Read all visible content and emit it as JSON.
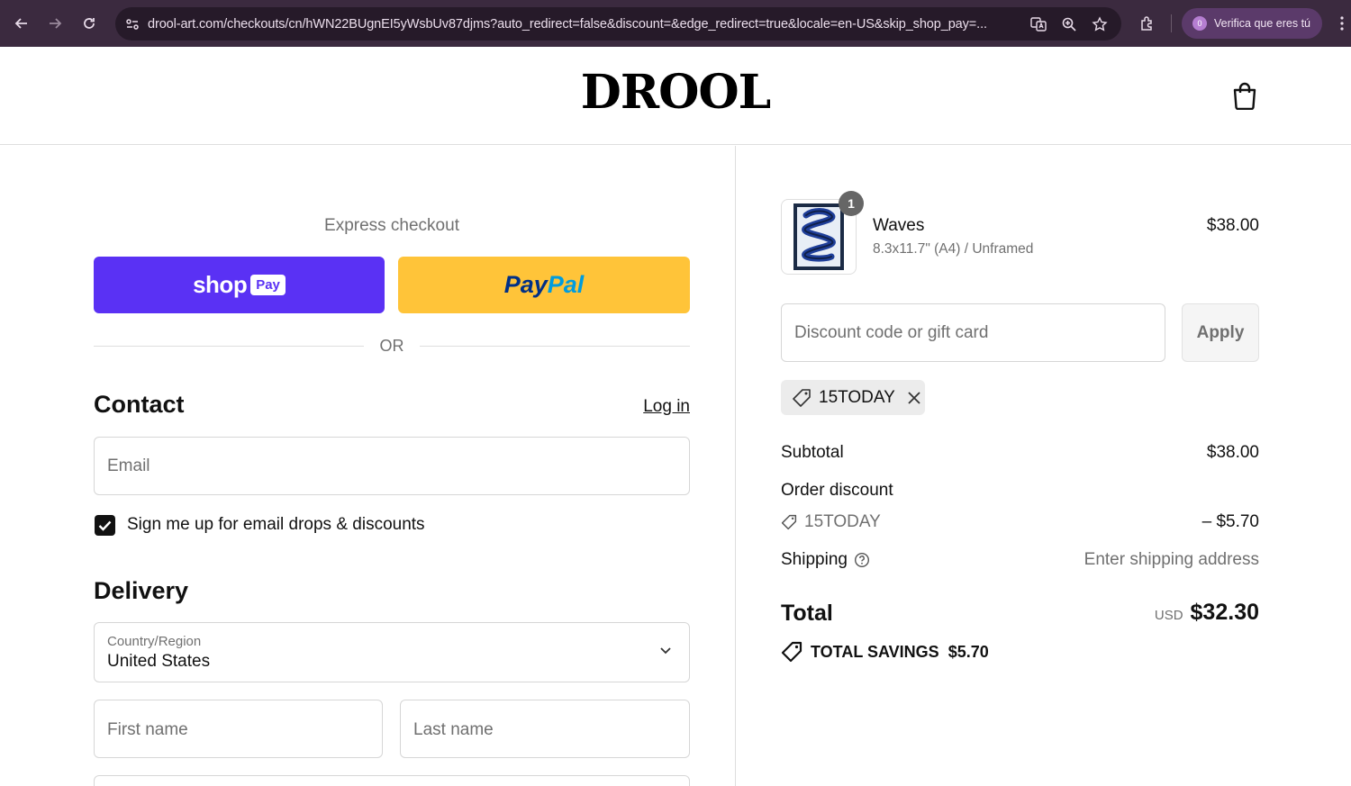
{
  "browser": {
    "url": "drool-art.com/checkouts/cn/hWN22BUgnEI5yWsbUv87djms?auto_redirect=false&discount=&edge_redirect=true&locale=en-US&skip_shop_pay=...",
    "profile_label": "Verifica que eres tú",
    "profile_initial": "0"
  },
  "header": {
    "logo": "DROOL"
  },
  "express": {
    "label": "Express checkout",
    "shop_word": "shop",
    "shop_pay_badge": "Pay",
    "paypal_a": "Pay",
    "paypal_b": "Pal",
    "or": "OR"
  },
  "contact": {
    "title": "Contact",
    "login": "Log in",
    "email_placeholder": "Email",
    "newsletter_label": "Sign me up for email drops & discounts",
    "newsletter_checked": true
  },
  "delivery": {
    "title": "Delivery",
    "country_label": "Country/Region",
    "country_value": "United States",
    "first_name_placeholder": "First name",
    "last_name_placeholder": "Last name"
  },
  "cart": {
    "item": {
      "name": "Waves",
      "variant": "8.3x11.7\" (A4) / Unframed",
      "price": "$38.00",
      "quantity": "1"
    },
    "discount_placeholder": "Discount code or gift card",
    "apply_label": "Apply",
    "applied_code": "15TODAY",
    "subtotal_label": "Subtotal",
    "subtotal_value": "$38.00",
    "order_discount_label": "Order discount",
    "discount_code": "15TODAY",
    "discount_value": "– $5.70",
    "shipping_label": "Shipping",
    "shipping_value": "Enter shipping address",
    "total_label": "Total",
    "total_currency": "USD",
    "total_value": "$32.30",
    "savings_label": "TOTAL SAVINGS",
    "savings_value": "$5.70"
  },
  "colors": {
    "shop_pay": "#5a31f4",
    "paypal": "#ffc439",
    "chrome": "#3b2a3f"
  }
}
